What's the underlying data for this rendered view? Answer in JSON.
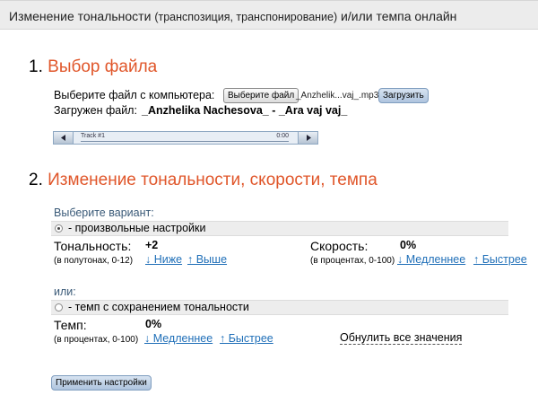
{
  "header": {
    "title_main": "Изменение тональности",
    "title_paren": "(транспозиция, транспонирование)",
    "title_tail": "и/или темпа онлайн"
  },
  "step1": {
    "number": "1.",
    "title": "Выбор файла",
    "choose_label": "Выберите файл с компьютера:",
    "choose_button": "Выберите файл",
    "chosen_file": "_Anzhelik...vaj_.mp3",
    "upload_button": "Загрузить",
    "loaded_label": "Загружен файл:",
    "loaded_file": "_Anzhelika Nachesova_ - _Ara vaj vaj_"
  },
  "player": {
    "track": "Track #1",
    "time": "0:00",
    "prev_icon": "rewind-icon",
    "play_icon": "play-icon"
  },
  "step2": {
    "number": "2.",
    "title": "Изменение тональности, скорости, темпа",
    "choose_variant": "Выберите вариант:",
    "option_custom": "- произвольные настройки",
    "pitch_label": "Тональность:",
    "pitch_value": "+2",
    "pitch_hint": "(в полутонах, 0-12)",
    "pitch_down": "↓ Ниже",
    "pitch_up": "↑ Выше",
    "speed_label": "Скорость:",
    "speed_value": "0%",
    "speed_hint": "(в процентах, 0-100)",
    "speed_slower": "↓ Медленнее",
    "speed_faster": "↑ Быстрее",
    "or_label": "или:",
    "option_tempo": "- темп с сохранением тональности",
    "tempo_label": "Темп:",
    "tempo_value": "0%",
    "tempo_hint": "(в процентах, 0-100)",
    "tempo_slower": "↓ Медленнее",
    "tempo_faster": "↑ Быстрее",
    "reset_label": "Обнулить все значения",
    "apply_button": "Применить настройки"
  },
  "colors": {
    "accent": "#e0562a",
    "link": "#1f6fb8",
    "header_bg": "#ececec"
  }
}
